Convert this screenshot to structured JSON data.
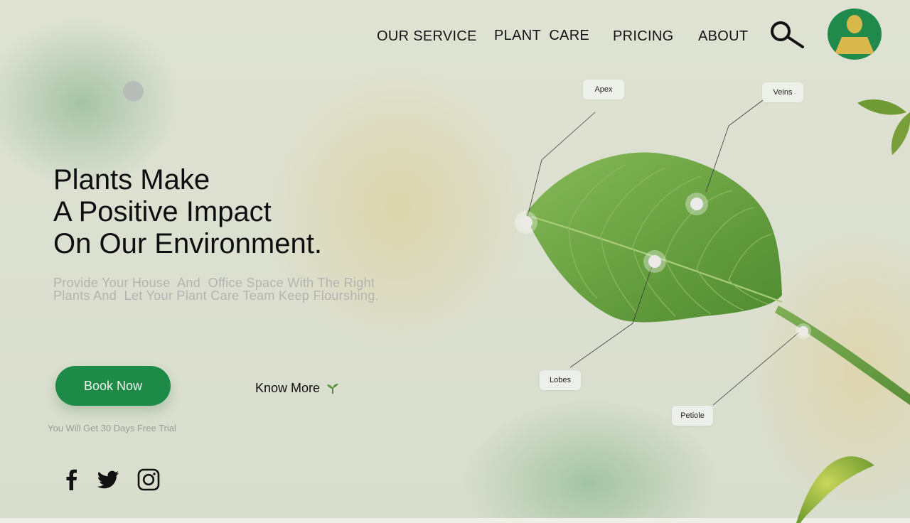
{
  "nav": {
    "items": [
      "OUR SERVICE",
      "PLANT  CARE",
      "PRICING",
      "ABOUT"
    ]
  },
  "hero": {
    "headline": [
      "Plants Make",
      "A Positive Impact",
      "On Our Environment."
    ],
    "subtext": [
      "Provide Your House  And  Office Space With The Right",
      "Plants And  Let Your Plant Care Team Keep Flourshing."
    ],
    "book_label": "Book Now",
    "trial_note": "You Will Get 30 Days Free Trial",
    "know_more_label": "Know More"
  },
  "leaf_labels": {
    "apex": "Apex",
    "veins": "Veins",
    "lobes": "Lobes",
    "petiole": "Petiole"
  },
  "social": [
    "facebook-icon",
    "twitter-icon",
    "instagram-icon"
  ],
  "colors": {
    "accent": "#1e8a48",
    "avatar_bg": "#1f8a4c",
    "avatar_figure": "#d8b84a",
    "leaf": "#6fa64a"
  }
}
